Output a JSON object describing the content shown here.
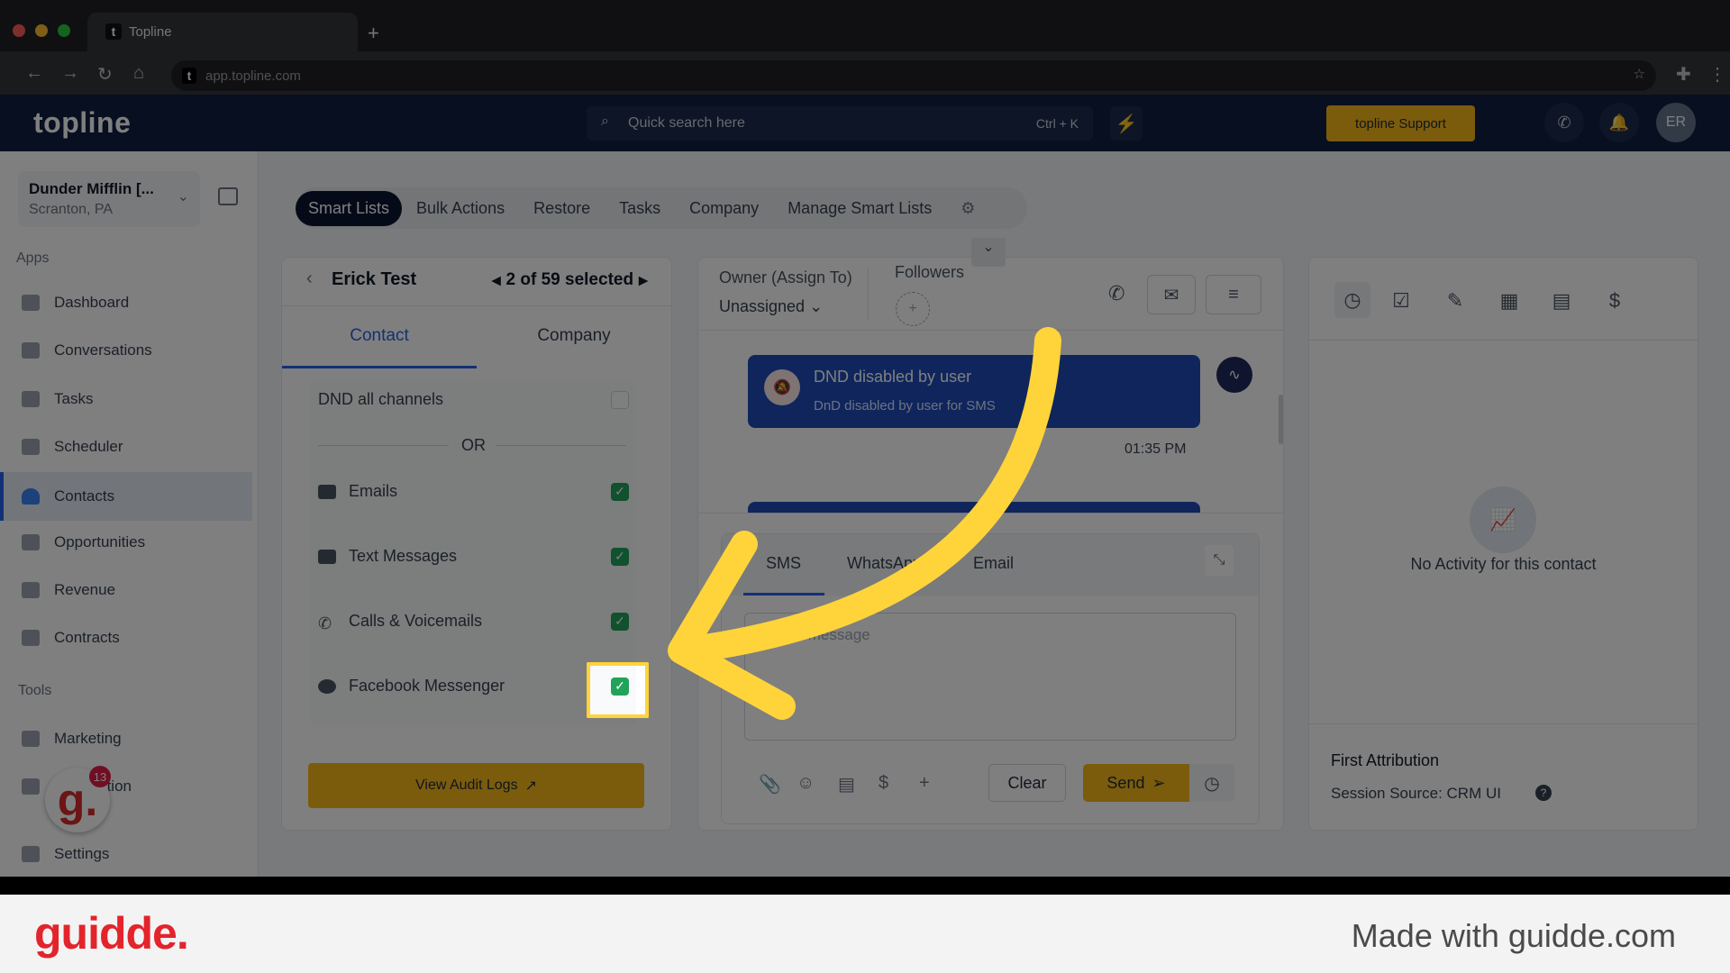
{
  "browser": {
    "tab_title": "Topline",
    "url": "app.topline.com",
    "new_tab": "+"
  },
  "header": {
    "logo": "topline",
    "search_placeholder": "Quick search here",
    "search_shortcut": "Ctrl + K",
    "support_label": "topline Support",
    "avatar_initials": "ER"
  },
  "sidebar": {
    "company_name": "Dunder Mifflin [...",
    "company_location": "Scranton, PA",
    "apps_label": "Apps",
    "tools_label": "Tools",
    "apps": [
      {
        "label": "Dashboard"
      },
      {
        "label": "Conversations"
      },
      {
        "label": "Tasks"
      },
      {
        "label": "Scheduler"
      },
      {
        "label": "Contacts",
        "active": true
      },
      {
        "label": "Opportunities"
      },
      {
        "label": "Revenue"
      },
      {
        "label": "Contracts"
      }
    ],
    "tools": [
      {
        "label": "Marketing"
      },
      {
        "label": "Automation"
      }
    ],
    "settings_label": "Settings",
    "notification_count": "13"
  },
  "topnav": {
    "tabs": [
      {
        "label": "Smart Lists",
        "active": true
      },
      {
        "label": "Bulk Actions"
      },
      {
        "label": "Restore"
      },
      {
        "label": "Tasks"
      },
      {
        "label": "Company"
      },
      {
        "label": "Manage Smart Lists"
      }
    ]
  },
  "contact_panel": {
    "name": "Erick Test",
    "selection": "2 of 59 selected",
    "tabs": [
      "Contact",
      "Company"
    ],
    "active_tab": "Contact",
    "dnd_all_label": "DND all channels",
    "dnd_all_checked": false,
    "or_label": "OR",
    "channels": [
      {
        "label": "Emails",
        "checked": true
      },
      {
        "label": "Text Messages",
        "checked": true
      },
      {
        "label": "Calls & Voicemails",
        "checked": true
      },
      {
        "label": "Facebook Messenger",
        "checked": true
      }
    ],
    "audit_button": "View Audit Logs"
  },
  "conversation": {
    "owner_label": "Owner (Assign To)",
    "owner_value": "Unassigned",
    "followers_label": "Followers",
    "message": {
      "title": "DND disabled by user",
      "subtitle": "DnD disabled by user for SMS",
      "time": "01:35 PM"
    },
    "composer_tabs": [
      "SMS",
      "WhatsApp",
      "Email"
    ],
    "active_composer_tab": "SMS",
    "message_placeholder": "Type a message",
    "clear_label": "Clear",
    "send_label": "Send"
  },
  "activity": {
    "empty_text": "No Activity for this contact",
    "attribution_title": "First Attribution",
    "session_source": "Session Source: CRM UI"
  },
  "footer": {
    "brand": "guidde.",
    "tagline": "Made with guidde.com"
  },
  "colors": {
    "accent": "#2563eb",
    "brand_yellow": "#f6b91b",
    "success": "#22a35a",
    "header_bg": "#0f1f43",
    "annotation": "#ffd43b"
  }
}
